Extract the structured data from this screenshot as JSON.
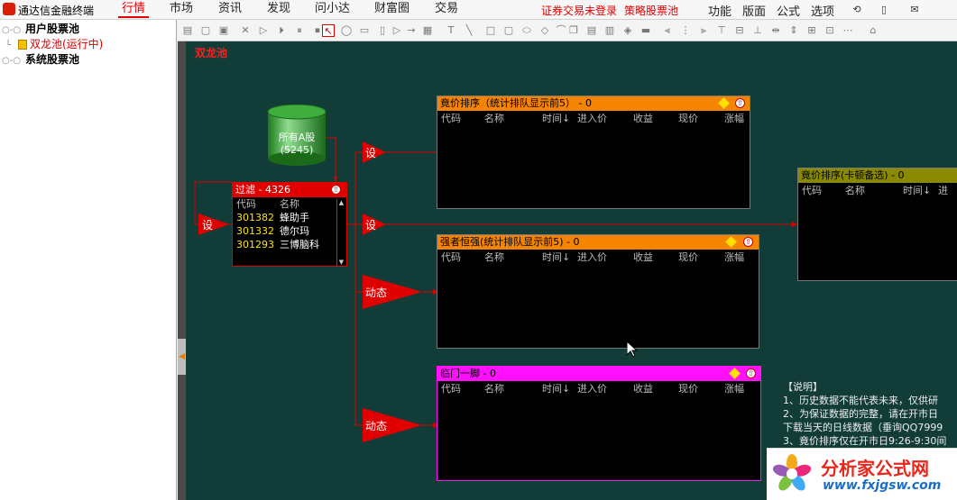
{
  "app": {
    "title": "通达信金融终端",
    "accent": "#e00000"
  },
  "menu": {
    "items": [
      "行情",
      "市场",
      "资讯",
      "发现",
      "问小达",
      "财富圈",
      "交易"
    ],
    "active": "行情",
    "notice": "证券交易未登录",
    "pool_link": "策略股票池",
    "right_items": [
      "功能",
      "版面",
      "公式",
      "选项"
    ]
  },
  "tree": {
    "items": [
      {
        "label": "用户股票池"
      },
      {
        "label": "双龙池(运行中)"
      },
      {
        "label": "系统股票池"
      }
    ]
  },
  "canvas": {
    "background": "#123c38",
    "pool_title": "双龙池",
    "source": {
      "title": "所有A股",
      "count": "(5245)"
    },
    "filter": {
      "title": "过滤 - 4326",
      "columns": [
        "代码",
        "名称"
      ],
      "rows": [
        {
          "code": "301382",
          "name": "蜂助手"
        },
        {
          "code": "301332",
          "name": "德尔玛"
        },
        {
          "code": "301293",
          "name": "三博脑科"
        }
      ]
    },
    "nodes": {
      "set": "设",
      "dynamic": "动态"
    },
    "panels": [
      {
        "title": "竟价排序（统计排队显示前5） - 0",
        "color": "#f58400"
      },
      {
        "title": "竟价排序(卡顿备选) - 0",
        "color": "#8a8a00"
      },
      {
        "title": "强者恒强(统计排队显示前5) - 0",
        "color": "#f58400"
      },
      {
        "title": "临门一脚 - 0",
        "color": "#ff10ff"
      }
    ],
    "columns": [
      "代码",
      "名称",
      "时间↓",
      "进入价",
      "收益",
      "现价",
      "涨幅"
    ],
    "columns_short": [
      "代码",
      "名称",
      "时间↓",
      "进"
    ],
    "notes": [
      "【说明】",
      "1、历史数据不能代表未来，仅供研",
      "2、为保证数据的完整，请在开市日",
      "下载当天的日线数据（垂询QQ7999",
      "3、竟价排序仅在开市日9:26-9:30间"
    ]
  },
  "watermark": {
    "cn": "分析家公式网",
    "url": "www.fxjgsw.com"
  }
}
